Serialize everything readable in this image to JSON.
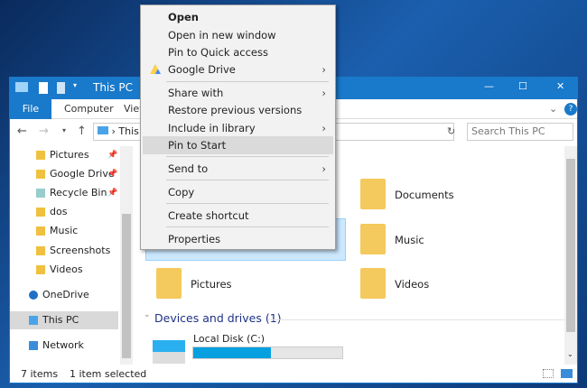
{
  "window": {
    "title": "This PC",
    "controls": {
      "minimize": "—",
      "maximize": "☐",
      "close": "✕"
    }
  },
  "ribbon": {
    "tabs": [
      "File",
      "Computer",
      "View"
    ],
    "help": "?",
    "expand": "⌄"
  },
  "address": {
    "path": "This PC",
    "separator": "›",
    "refresh": "↻",
    "search_placeholder": "Search This PC"
  },
  "nav": {
    "items": [
      {
        "label": "Pictures",
        "pinned": true
      },
      {
        "label": "Google Drive",
        "pinned": true
      },
      {
        "label": "Recycle Bin",
        "pinned": true
      },
      {
        "label": "dos"
      },
      {
        "label": "Music"
      },
      {
        "label": "Screenshots"
      },
      {
        "label": "Videos"
      },
      {
        "label": "OneDrive"
      },
      {
        "label": "This PC",
        "selected": true
      },
      {
        "label": "Network"
      }
    ]
  },
  "content": {
    "folders": [
      "Documents",
      "Music",
      "Pictures",
      "Videos"
    ],
    "devices_header": "Devices and drives (1)",
    "drive": {
      "label": "Local Disk (C:)",
      "used_fraction": 0.52
    }
  },
  "status": {
    "items": "7 items",
    "selected": "1 item selected"
  },
  "context_menu": {
    "items": [
      {
        "label": "Open",
        "bold": true
      },
      {
        "label": "Open in new window"
      },
      {
        "label": "Pin to Quick access"
      },
      {
        "label": "Google Drive",
        "submenu": true
      },
      {
        "label": "Share with",
        "submenu": true
      },
      {
        "label": "Restore previous versions"
      },
      {
        "label": "Include in library",
        "submenu": true
      },
      {
        "label": "Pin to Start",
        "highlighted": true
      },
      {
        "label": "Send to",
        "submenu": true
      },
      {
        "label": "Copy"
      },
      {
        "label": "Create shortcut"
      },
      {
        "label": "Properties"
      }
    ]
  },
  "colors": {
    "accent": "#1979ca",
    "progress": "#06a0e0",
    "header": "#1e3287"
  }
}
